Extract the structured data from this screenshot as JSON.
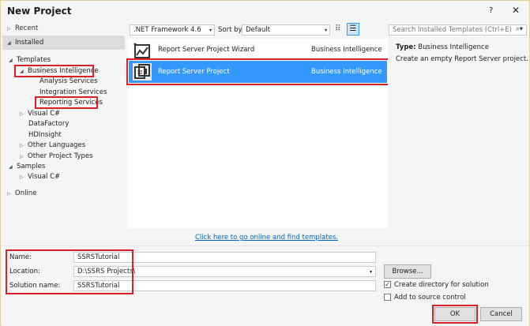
{
  "title": "New Project",
  "help": "?",
  "close": "✕",
  "tree": {
    "recent": "Recent",
    "installed": "Installed",
    "templates": "Templates",
    "bi": "Business Intelligence",
    "analysis": "Analysis Services",
    "integration": "Integration Services",
    "reporting": "Reporting Services",
    "visualcs": "Visual C#",
    "datafactory": "DataFactory",
    "hdinsight": "HDInsight",
    "otherlang": "Other Languages",
    "otherproj": "Other Project Types",
    "samples": "Samples",
    "samples_vcs": "Visual C#",
    "online": "Online"
  },
  "toolbar": {
    "framework": ".NET Framework 4.6",
    "sort_label": "Sort by:",
    "sort_value": "Default"
  },
  "search": {
    "placeholder": "Search Installed Templates (Ctrl+E)"
  },
  "templates": [
    {
      "name": "Report Server Project Wizard",
      "type": "Business Intelligence"
    },
    {
      "name": "Report Server Project",
      "type": "Business Intelligence"
    }
  ],
  "details": {
    "type_label": "Type:",
    "type_value": "Business Intelligence",
    "description": "Create an empty Report Server project."
  },
  "online_link": "Click here to go online and find templates.",
  "form": {
    "name_label": "Name:",
    "name_value": "SSRSTutorial",
    "location_label": "Location:",
    "location_value": "D:\\SSRS Projects\\",
    "solution_label": "Solution name:",
    "solution_value": "SSRSTutorial",
    "browse": "Browse...",
    "create_dir": "Create directory for solution",
    "create_dir_checked": true,
    "source_control": "Add to source control",
    "source_control_checked": false
  },
  "buttons": {
    "ok": "OK",
    "cancel": "Cancel"
  },
  "colors": {
    "selection": "#3399ff",
    "highlight": "#d7202a"
  }
}
